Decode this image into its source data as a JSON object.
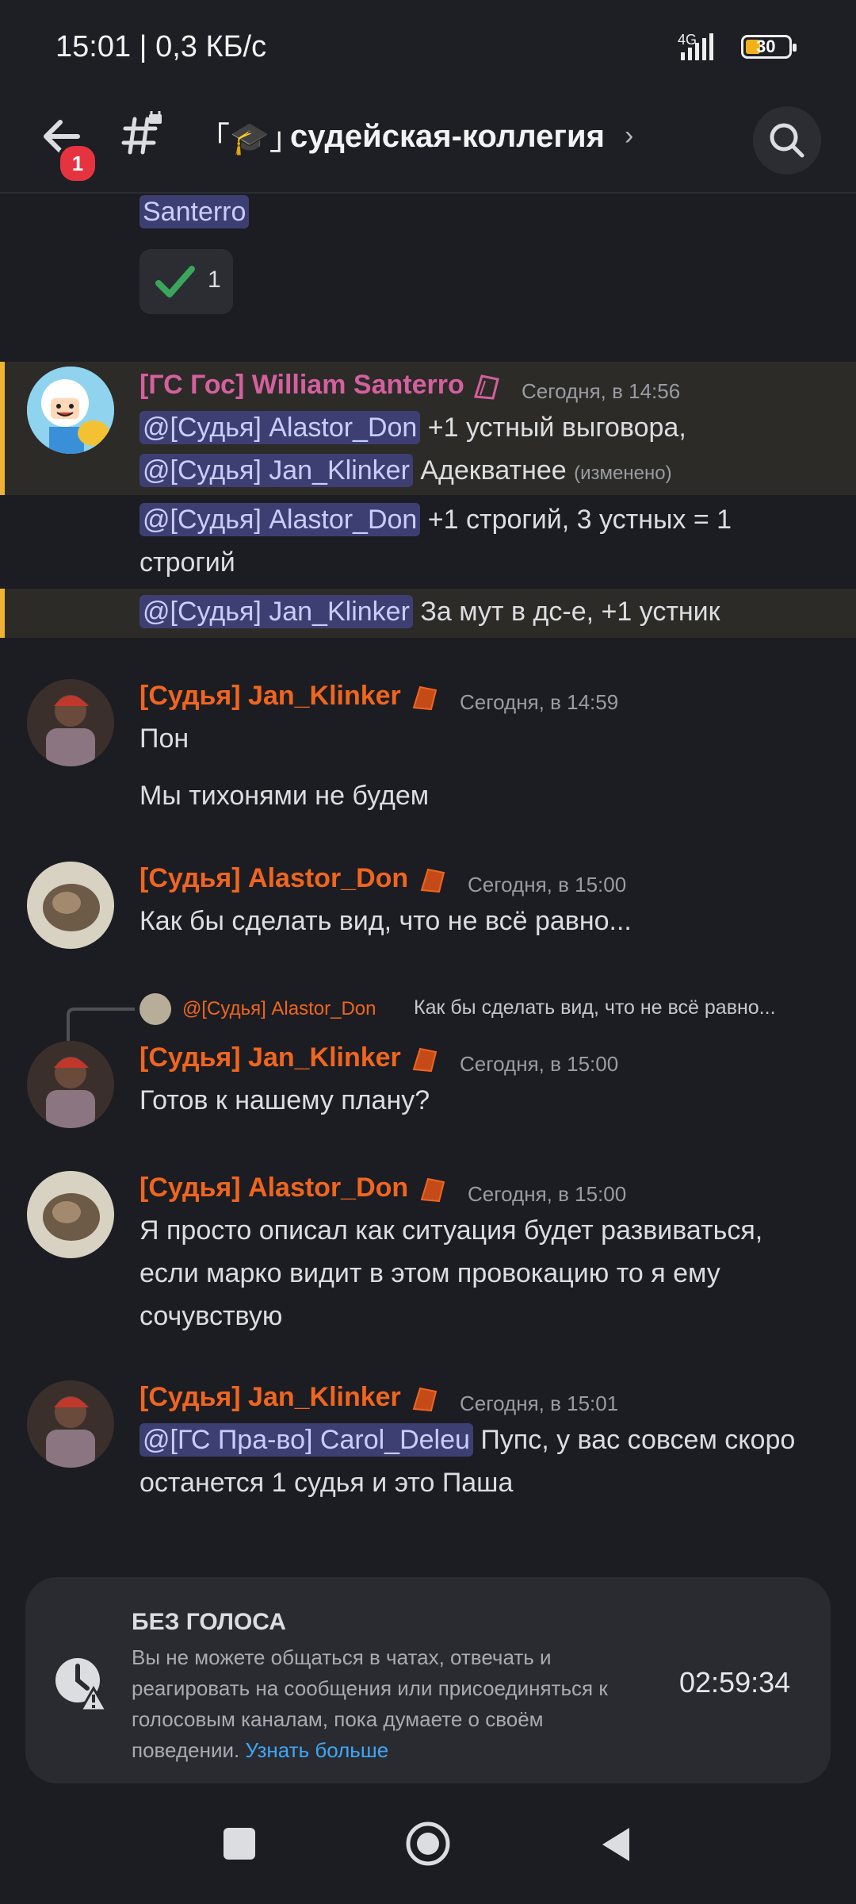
{
  "status_bar": {
    "time": "15:01 | 0,3 КБ/с",
    "network": "4G",
    "battery": "30"
  },
  "header": {
    "unread_count": "1",
    "channel_icon": "🎓",
    "channel_name": "「🎓」 судейская-коллегия",
    "channel_title": "судейская-коллегия"
  },
  "messages": {
    "top_fragment": {
      "mention": "Santerro",
      "reaction_count": "1"
    },
    "m1": {
      "author": "[ГС Гос] William Santerro",
      "timestamp": "Сегодня, в 14:56",
      "line1_mention": "@[Судья] Alastor_Don",
      "line1_text": "+1 устный выговора,",
      "line2_mention": "@[Судья] Jan_Klinker",
      "line2_text": "Адекватнее",
      "edited": "(изменено)",
      "line3_mention": "@[Судья] Alastor_Don",
      "line3_text": "+1 строгий, 3 устных = 1",
      "line4_text": "строгий",
      "line5_mention": "@[Судья] Jan_Klinker",
      "line5_text": "За мут в дс-е, +1 устник"
    },
    "m2": {
      "author": "[Судья] Jan_Klinker",
      "timestamp": "Сегодня, в 14:59",
      "line1": "Пон",
      "line2": "Мы тихонями не будем"
    },
    "m3": {
      "author": "[Судья] Alastor_Don",
      "timestamp": "Сегодня, в 15:00",
      "line1": "Как бы сделать вид, что не всё равно..."
    },
    "m4": {
      "reply_author": "@[Судья] Alastor_Don",
      "reply_text": "Как бы сделать вид, что не всё равно...",
      "author": "[Судья] Jan_Klinker",
      "timestamp": "Сегодня, в 15:00",
      "line1": "Готов к нашему плану?"
    },
    "m5": {
      "author": "[Судья] Alastor_Don",
      "timestamp": "Сегодня, в 15:00",
      "line1": "Я просто описал как ситуация будет развиваться,",
      "line2": "если марко видит в этом провокацию то я ему",
      "line3": "сочувствую"
    },
    "m6": {
      "author": "[Судья] Jan_Klinker",
      "timestamp": "Сегодня, в 15:01",
      "line1_mention": "@[ГС Пра-во] Carol_Deleu",
      "line1_text": "Пупс, у вас совсем скоро",
      "line2": "останется 1 судья и это Паша"
    }
  },
  "mute_notice": {
    "title": "БЕЗ ГОЛОСА",
    "description": "Вы не можете общаться в чатах, отвечать и реагировать на сообщения или присоединяться к голосовым каналам, пока думаете о своём поведении.",
    "link": "Узнать больше",
    "timer": "02:59:34"
  },
  "colors": {
    "background": "#1c1d22",
    "mention_bg": "#3d3f73",
    "judge_name": "#f0651f",
    "gov_name": "#d4609f",
    "highlight_bar": "#f0b232",
    "link": "#3fa7f5"
  }
}
